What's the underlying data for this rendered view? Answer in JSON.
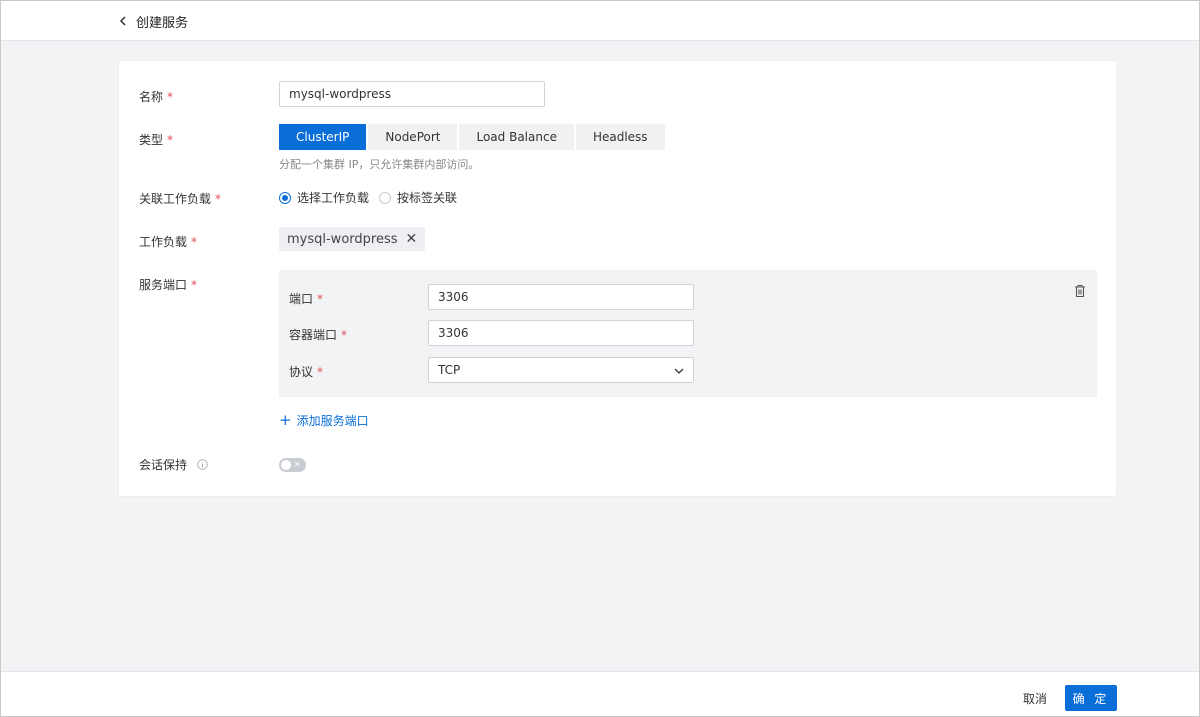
{
  "header": {
    "title": "创建服务"
  },
  "form": {
    "name": {
      "label": "名称",
      "value": "mysql-wordpress"
    },
    "type": {
      "label": "类型",
      "options": [
        "ClusterIP",
        "NodePort",
        "Load Balance",
        "Headless"
      ],
      "selected": "ClusterIP",
      "hint": "分配一个集群 IP，只允许集群内部访问。"
    },
    "workload_link": {
      "label": "关联工作负载",
      "options": [
        "选择工作负载",
        "按标签关联"
      ],
      "selected": "选择工作负载"
    },
    "workload": {
      "label": "工作负载",
      "tag": "mysql-wordpress"
    },
    "service_ports": {
      "label": "服务端口",
      "port": {
        "label": "端口",
        "value": "3306"
      },
      "container_port": {
        "label": "容器端口",
        "value": "3306"
      },
      "protocol": {
        "label": "协议",
        "value": "TCP"
      },
      "add_label": "添加服务端口"
    },
    "session_affinity": {
      "label": "会话保持",
      "enabled": false
    }
  },
  "footer": {
    "cancel": "取消",
    "confirm": "确 定"
  },
  "colors": {
    "primary": "#0a6ed9",
    "required": "#e34d59",
    "background": "#f2f3f5"
  }
}
